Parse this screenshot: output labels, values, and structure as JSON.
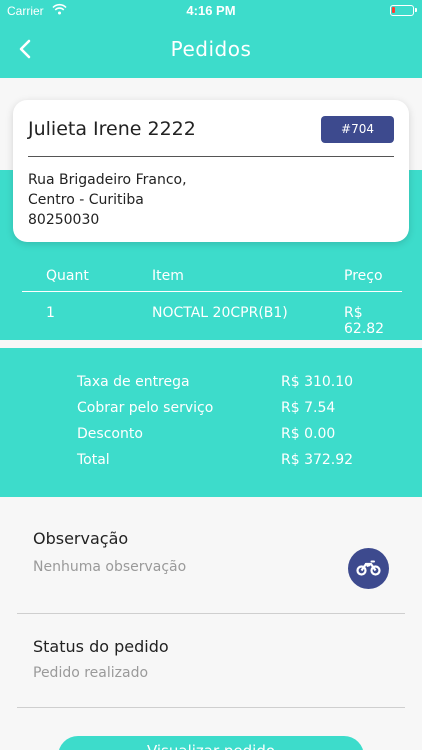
{
  "status_bar": {
    "carrier": "Carrier",
    "time": "4:16 PM"
  },
  "header": {
    "title": "Pedidos"
  },
  "order": {
    "customer": "Julieta Irene 2222",
    "number": "#704",
    "address_line1": "Rua Brigadeiro Franco,",
    "address_line2": "Centro - Curitiba",
    "zip": "80250030"
  },
  "items_table": {
    "headers": [
      "Quant",
      "Item",
      "Preço"
    ],
    "rows": [
      {
        "qty": "1",
        "item": "NOCTAL 20CPR(B1)",
        "price": "R$ 62.82"
      }
    ]
  },
  "totals": [
    {
      "label": "Taxa de entrega",
      "value": "R$ 310.10"
    },
    {
      "label": "Cobrar pelo serviço",
      "value": "R$ 7.54"
    },
    {
      "label": "Desconto",
      "value": "R$ 0.00"
    },
    {
      "label": "Total",
      "value": "R$ 372.92"
    }
  ],
  "notes": {
    "title": "Observação",
    "text": "Nenhuma observação"
  },
  "status": {
    "title": "Status do pedido",
    "text": "Pedido realizado"
  },
  "bottom_button": {
    "label": "Visualizar pedido"
  },
  "icons": {
    "back": "chevron-left-icon",
    "delivery": "motorcycle-icon",
    "wifi": "wifi-icon",
    "battery": "battery-icon"
  },
  "colors": {
    "primary": "#3ddccb",
    "badge": "#3d4a8e",
    "background": "#f7f7f7"
  }
}
